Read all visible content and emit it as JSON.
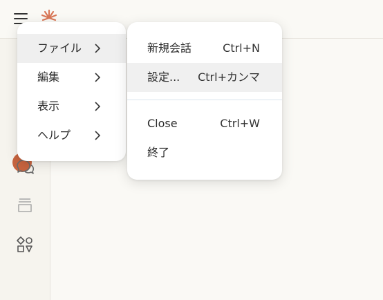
{
  "app": {
    "accent_color": "#c8643f"
  },
  "topbar": {
    "menu_icon": "hamburger-menu-icon",
    "logo_icon": "sunburst-logo-icon"
  },
  "sidebar": {
    "icons": [
      "avatar",
      "chat-bubbles-icon",
      "archive-box-icon",
      "shapes-icon"
    ]
  },
  "main_menu": {
    "items": [
      {
        "label": "ファイル",
        "active": true
      },
      {
        "label": "編集",
        "active": false
      },
      {
        "label": "表示",
        "active": false
      },
      {
        "label": "ヘルプ",
        "active": false
      }
    ]
  },
  "file_menu": {
    "items": [
      {
        "label": "新規会話",
        "shortcut": "Ctrl+N"
      },
      {
        "label": "設定...",
        "shortcut": "Ctrl+カンマ"
      },
      {
        "label": "Close",
        "shortcut": "Ctrl+W"
      },
      {
        "label": "終了",
        "shortcut": ""
      }
    ]
  }
}
